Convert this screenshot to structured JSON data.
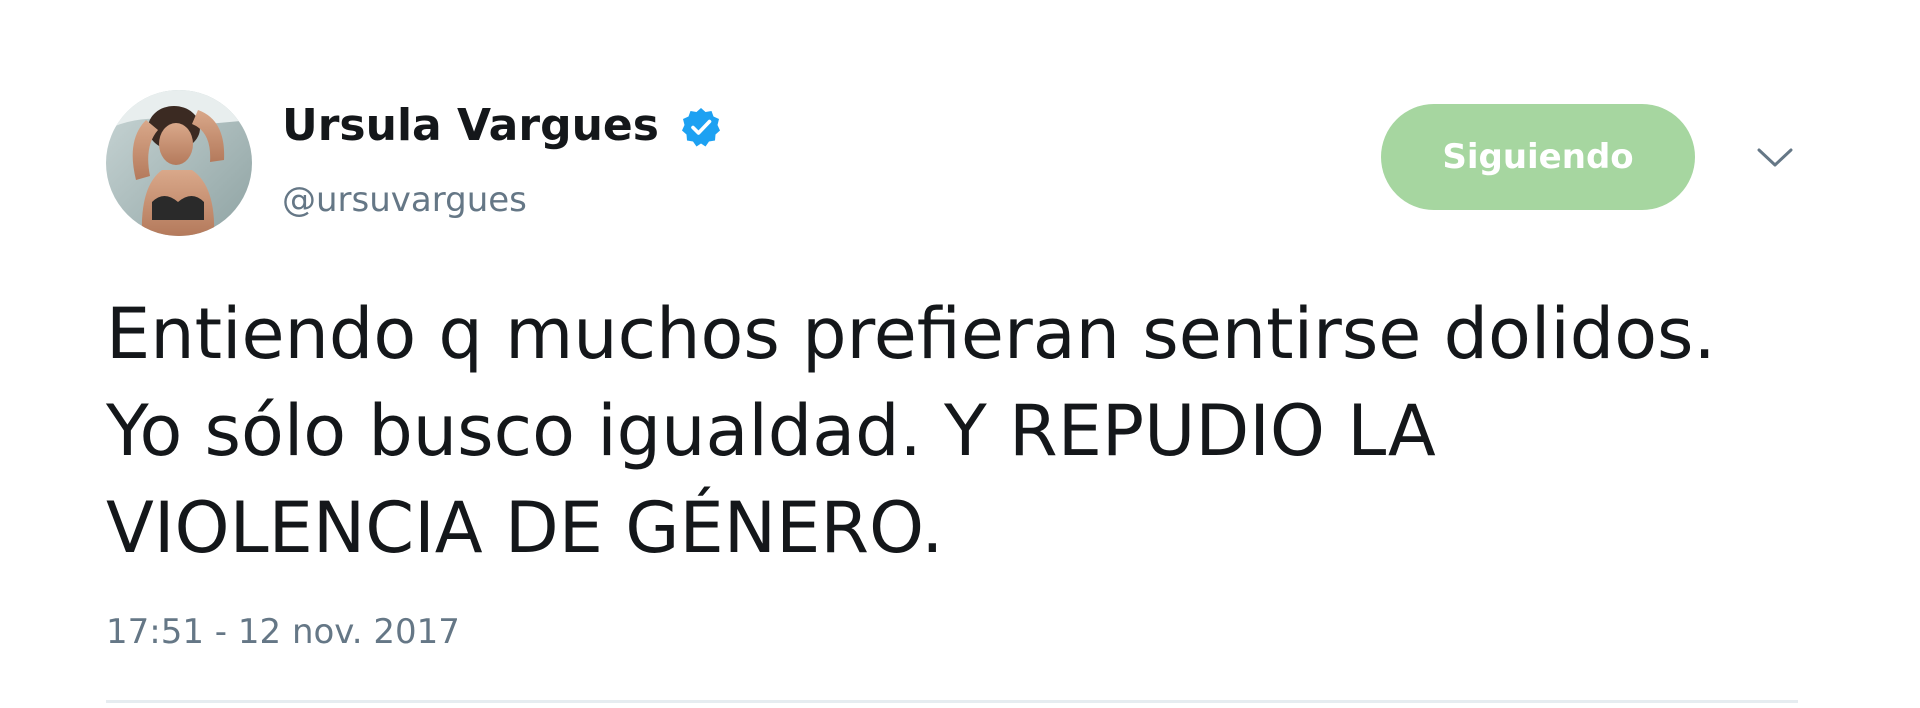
{
  "tweet": {
    "author": {
      "display_name": "Ursula Vargues",
      "handle": "@ursuvargues",
      "verified_icon": "verified-badge-icon",
      "avatar": "profile-photo"
    },
    "follow_button_label": "Siguiendo",
    "menu_icon": "chevron-down-icon",
    "text_lines": [
      "Entiendo q muchos prefieran sentirse dolidos.",
      "Yo sólo busco igualdad. Y REPUDIO LA",
      "VIOLENCIA DE GÉNERO."
    ],
    "timestamp": "17:51 - 12 nov. 2017"
  },
  "colors": {
    "follow_button_bg": "#a6d6a0",
    "verified_blue": "#1da1f2",
    "secondary_text": "#657786",
    "primary_text": "#14171a"
  }
}
